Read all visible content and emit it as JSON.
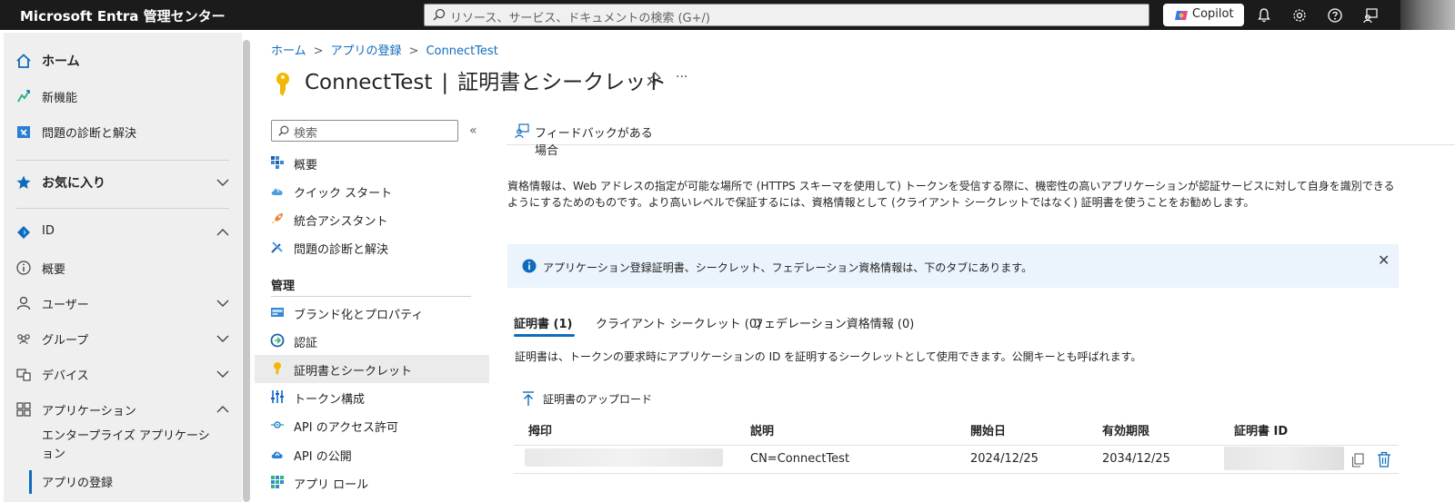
{
  "topbar": {
    "brand": "Microsoft Entra 管理センター",
    "search_placeholder": "リソース、サービス、ドキュメントの検索 (G+/)",
    "copilot_label": "Copilot",
    "icons": [
      "bell-icon",
      "settings-icon",
      "help-icon",
      "feedback-icon"
    ]
  },
  "leftnav": {
    "items": [
      {
        "label": "ホーム",
        "icon": "home-icon"
      },
      {
        "label": "新機能",
        "icon": "whats-new-icon"
      },
      {
        "label": "問題の診断と解決",
        "icon": "diagnose-icon"
      },
      {
        "label": "お気に入り",
        "icon": "star-icon"
      },
      {
        "label": "ID",
        "icon": "identity-icon"
      },
      {
        "label": "概要",
        "icon": "info-icon"
      },
      {
        "label": "ユーザー",
        "icon": "user-icon"
      },
      {
        "label": "グループ",
        "icon": "group-icon"
      },
      {
        "label": "デバイス",
        "icon": "device-icon"
      },
      {
        "label": "アプリケーション",
        "icon": "apps-icon"
      },
      {
        "label": "エンタープライズ アプリケーション"
      },
      {
        "label": "アプリの登録"
      }
    ]
  },
  "breadcrumb": {
    "items": [
      "ホーム",
      "アプリの登録",
      "ConnectTest"
    ]
  },
  "page": {
    "app_name": "ConnectTest",
    "separator": "|",
    "section": "証明書とシークレット",
    "more": "···"
  },
  "subnav": {
    "search_placeholder": "検索",
    "collapse": "«",
    "items": [
      {
        "label": "概要",
        "icon": "overview-icon"
      },
      {
        "label": "クイック スタート",
        "icon": "cloud-icon"
      },
      {
        "label": "統合アシスタント",
        "icon": "rocket-icon"
      },
      {
        "label": "問題の診断と解決",
        "icon": "tools-icon"
      }
    ],
    "section_label": "管理",
    "manage_items": [
      {
        "label": "ブランド化とプロパティ",
        "icon": "branding-icon"
      },
      {
        "label": "認証",
        "icon": "auth-icon"
      },
      {
        "label": "証明書とシークレット",
        "icon": "key-icon"
      },
      {
        "label": "トークン構成",
        "icon": "token-icon"
      },
      {
        "label": "API のアクセス許可",
        "icon": "api-permission-icon"
      },
      {
        "label": "API の公開",
        "icon": "cloud-expose-icon"
      },
      {
        "label": "アプリ ロール",
        "icon": "app-roles-icon"
      }
    ]
  },
  "content": {
    "feedback": "フィードバックがある場合",
    "description": "資格情報は、Web アドレスの指定が可能な場所で (HTTPS スキーマを使用して) トークンを受信する際に、機密性の高いアプリケーションが認証サービスに対して自身を識別できるようにするためのものです。より高いレベルで保証するには、資格情報として (クライアント シークレットではなく) 証明書を使うことをお勧めします。",
    "info": "アプリケーション登録証明書、シークレット、フェデレーション資格情報は、下のタブにあります。",
    "info_close": "✕",
    "tabs": [
      "証明書 (1)",
      "クライアント シークレット (0)",
      "フェデレーション資格情報 (0)"
    ],
    "tab_description": "証明書は、トークンの要求時にアプリケーションの ID を証明するシークレットとして使用できます。公開キーとも呼ばれます。",
    "upload": "証明書のアップロード",
    "table": {
      "headers": [
        "拇印",
        "説明",
        "開始日",
        "有効期限",
        "証明書 ID"
      ],
      "rows": [
        {
          "thumbprint": "",
          "description": "CN=ConnectTest",
          "start": "2024/12/25",
          "expires": "2034/12/25",
          "cert_id": ""
        }
      ]
    }
  },
  "colors": {
    "accent": "#0f6cbd",
    "topbar": "#1b1b1b",
    "info_bg": "#ebf3fc",
    "key": "#f2b705"
  }
}
